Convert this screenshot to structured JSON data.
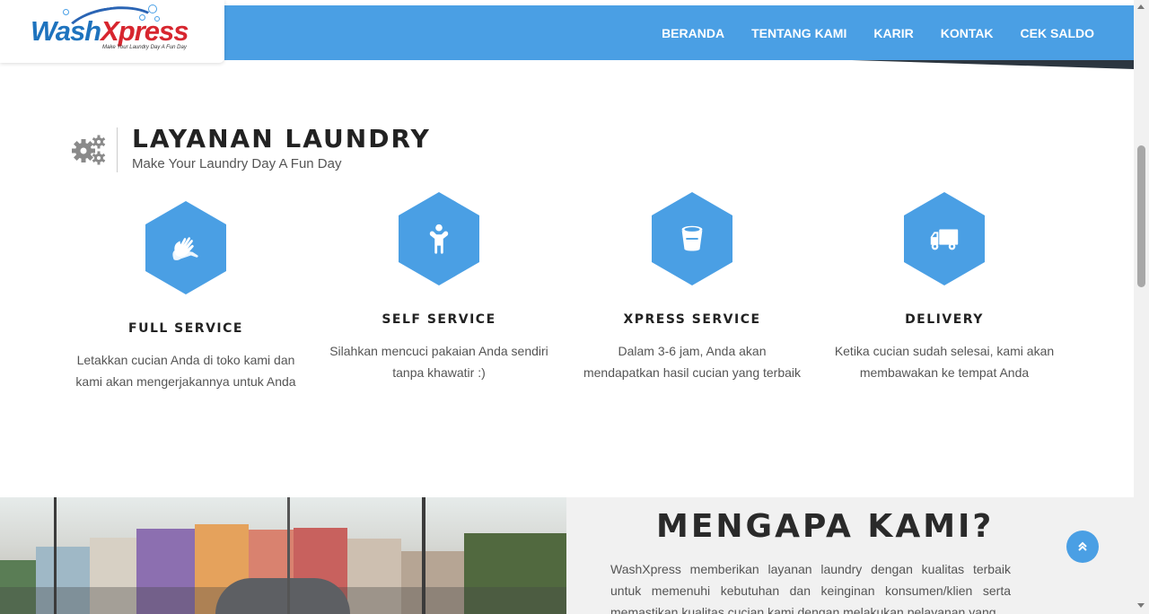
{
  "header": {
    "logo": {
      "text_wash": "Wash",
      "text_xpress": "Xpress",
      "tagline": "Make Your Laundry Day A Fun Day"
    },
    "nav": [
      "BERANDA",
      "TENTANG KAMI",
      "KARIR",
      "KONTAK",
      "CEK SALDO"
    ]
  },
  "section": {
    "title": "LAYANAN LAUNDRY",
    "subtitle": "Make Your Laundry Day A Fun Day",
    "icon": "gears-icon"
  },
  "services": [
    {
      "icon": "hands-icon",
      "title": "FULL SERVICE",
      "desc": "Letakkan cucian Anda di toko kami dan kami akan mengerjakannya untuk Anda"
    },
    {
      "icon": "person-icon",
      "title": "SELF SERVICE",
      "desc": "Silahkan mencuci pakaian Anda sendiri tanpa khawatir :)"
    },
    {
      "icon": "bucket-icon",
      "title": "XPRESS SERVICE",
      "desc": "Dalam 3-6 jam, Anda akan mendapatkan hasil cucian yang terbaik"
    },
    {
      "icon": "truck-icon",
      "title": "DELIVERY",
      "desc": "Ketika cucian sudah selesai, kami akan membawakan ke tempat Anda"
    }
  ],
  "why": {
    "title": "MENGAPA KAMI?",
    "text": "WashXpress memberikan layanan laundry dengan kualitas terbaik untuk memenuhi kebutuhan dan keinginan konsumen/klien serta memastikan kualitas cucian kami dengan melakukan pelayanan yang"
  },
  "colors": {
    "primary": "#4a9fe4",
    "logo_blue": "#1e73be",
    "logo_red": "#d7262f"
  }
}
